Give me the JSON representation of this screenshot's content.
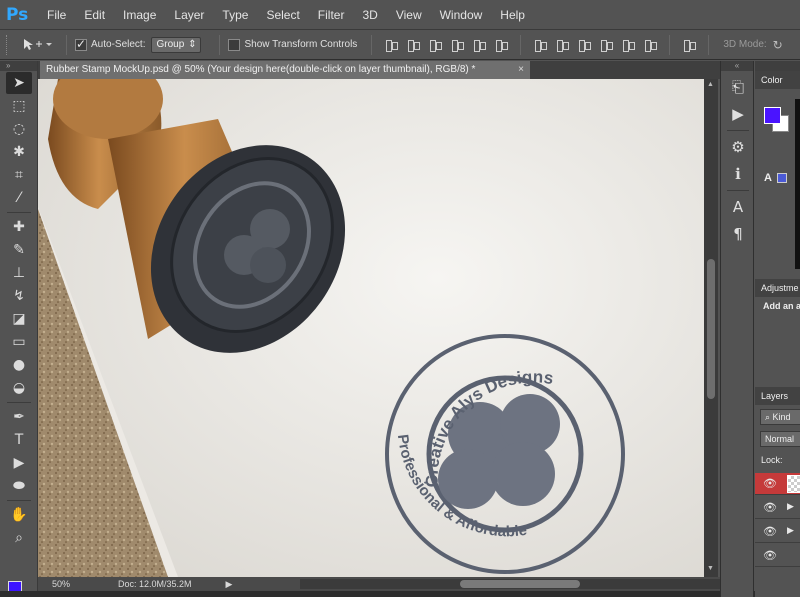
{
  "app": {
    "logo": "Ps"
  },
  "menu": [
    "File",
    "Edit",
    "Image",
    "Layer",
    "Type",
    "Select",
    "Filter",
    "3D",
    "View",
    "Window",
    "Help"
  ],
  "options": {
    "auto_select_label": "Auto-Select:",
    "auto_select_checked": true,
    "auto_select_target": "Group",
    "show_transform_label": "Show Transform Controls",
    "show_transform_checked": false,
    "mode_3d_label": "3D Mode:"
  },
  "document": {
    "tab_title": "Rubber Stamp MockUp.psd @ 50% (Your design here(double-click on layer thumbnail), RGB/8) *",
    "close_glyph": "×"
  },
  "status": {
    "zoom": "50%",
    "doc_info": "Doc: 12.0M/35.2M"
  },
  "artwork": {
    "stamp_top_text": "Creative Alys Designs",
    "stamp_bottom_text": "Professional & Affordable",
    "ink_color": "#5a6170"
  },
  "panels": {
    "color_tab": "Color",
    "adjustments_tab": "Adjustme",
    "adjustments_sub": "Add an a",
    "layers_tab": "Layers",
    "kind_filter": "Kind",
    "blend_mode": "Normal",
    "lock_label": "Lock:"
  },
  "colors": {
    "foreground": "#4a14ff",
    "background": "#ffffff",
    "selected_layer": "#c53a3a"
  }
}
